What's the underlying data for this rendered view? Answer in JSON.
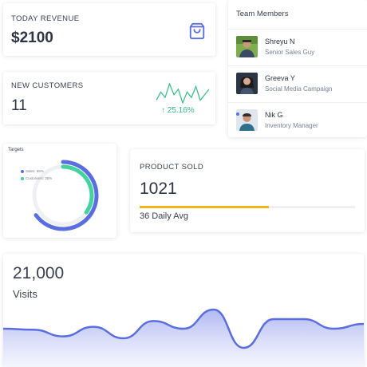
{
  "revenue": {
    "label": "TODAY REVENUE",
    "value": "$2100",
    "icon": "shopping-bag-icon"
  },
  "customers": {
    "label": "NEW CUSTOMERS",
    "value": "11",
    "growth": "↑ 25.16%",
    "accent": "#2fbf87"
  },
  "team": {
    "title": "Team Members",
    "members": [
      {
        "name": "Shreyu N",
        "role": "Senior Sales Guy"
      },
      {
        "name": "Greeva Y",
        "role": "Social Media Campaign"
      },
      {
        "name": "Nik G",
        "role": "Inventory Manager"
      }
    ]
  },
  "targets": {
    "title": "Targets",
    "legend": [
      {
        "label": "Sales: 65%",
        "color": "#5b6ee1"
      },
      {
        "label": "Customers: 35%",
        "color": "#43d39e"
      }
    ]
  },
  "product": {
    "label": "PRODUCT SOLD",
    "value": "1021",
    "progress": 0.6,
    "avg": "36 Daily Avg",
    "accent": "#f2b418"
  },
  "visits": {
    "value": "21,000",
    "label": "Visits",
    "accent": "#5b6ee1"
  },
  "chart_data": [
    {
      "type": "line",
      "series": [
        {
          "values": [
            3,
            6,
            4,
            9,
            5,
            7,
            2,
            6,
            4,
            8,
            3,
            5,
            7
          ]
        }
      ]
    },
    {
      "type": "pie",
      "series": [
        {
          "name": "Sales",
          "values": [
            65
          ]
        },
        {
          "name": "Customers",
          "values": [
            35
          ]
        }
      ]
    },
    {
      "type": "area",
      "series": [
        {
          "values": [
            30,
            31,
            38,
            28,
            40,
            22,
            30,
            10,
            50,
            20,
            20,
            30,
            25
          ]
        }
      ]
    }
  ]
}
